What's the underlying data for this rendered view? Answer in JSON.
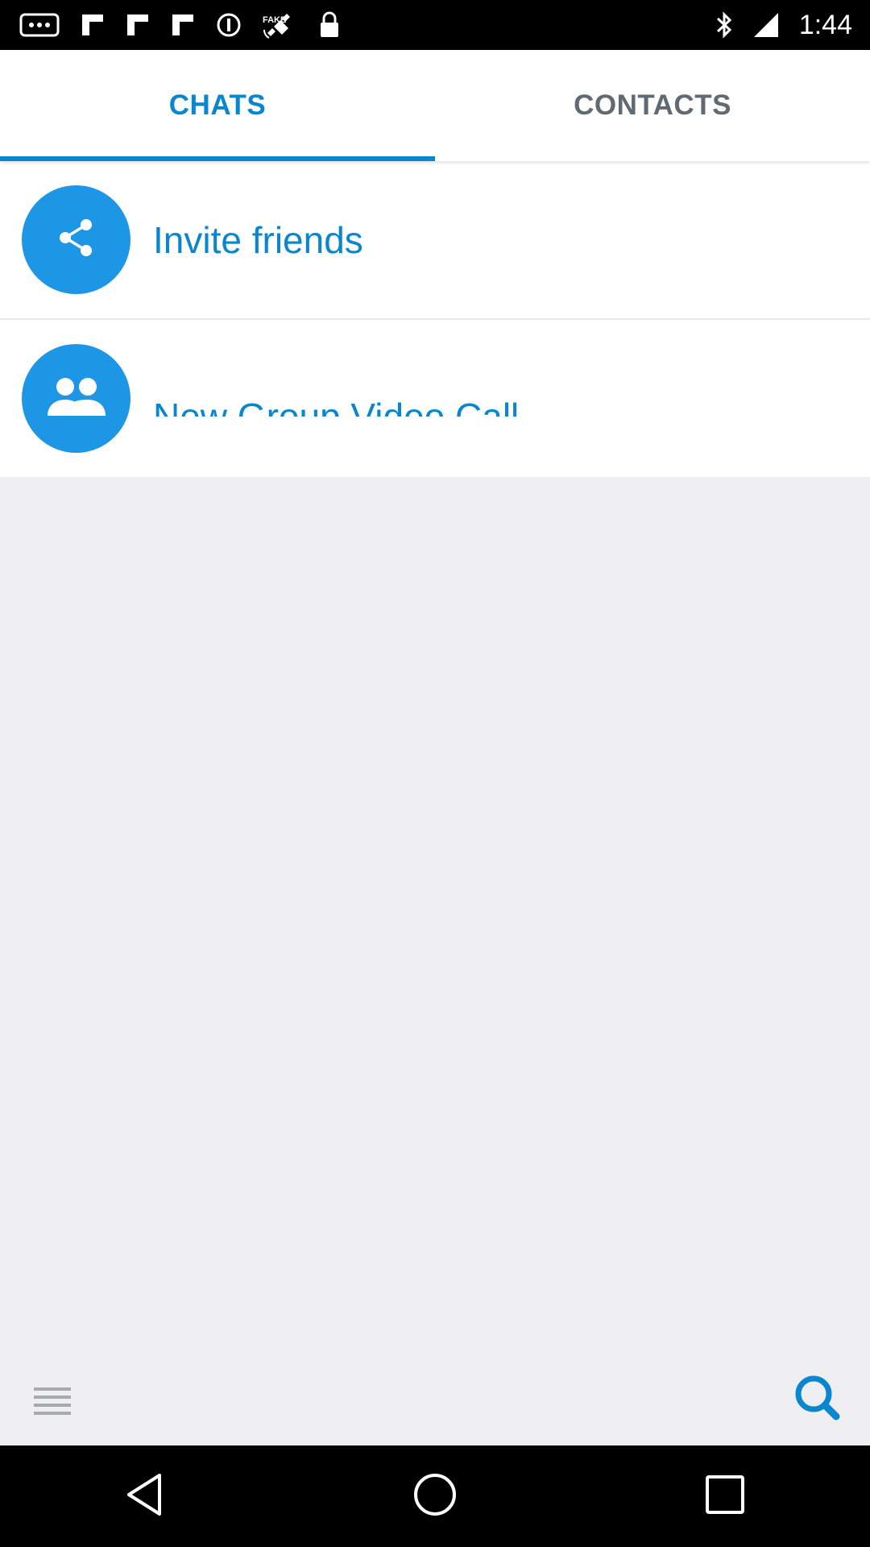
{
  "status_bar": {
    "time": "1:44",
    "left_icons": [
      "more-notifications-icon",
      "flipboard-icon",
      "flipboard-icon",
      "flipboard-icon",
      "sync-icon",
      "fake-gps-icon",
      "lock-icon"
    ],
    "fake_label": "FAKE",
    "right_icons": [
      "bluetooth-icon",
      "signal-icon"
    ]
  },
  "tabs": [
    {
      "label": "CHATS",
      "active": true
    },
    {
      "label": "CONTACTS",
      "active": false
    }
  ],
  "list": {
    "items": [
      {
        "label": "Invite friends",
        "icon": "share-icon"
      },
      {
        "label": "New Group Video Call",
        "icon": "group-icon"
      }
    ]
  },
  "bottom_bar": {
    "menu_icon": "menu-icon",
    "search_icon": "search-icon"
  },
  "nav_bar": {
    "icons": [
      "back-icon",
      "home-icon",
      "recents-icon"
    ]
  },
  "colors": {
    "accent": "#0a86cf",
    "avatar": "#1e96e6",
    "background": "#efeff2"
  }
}
